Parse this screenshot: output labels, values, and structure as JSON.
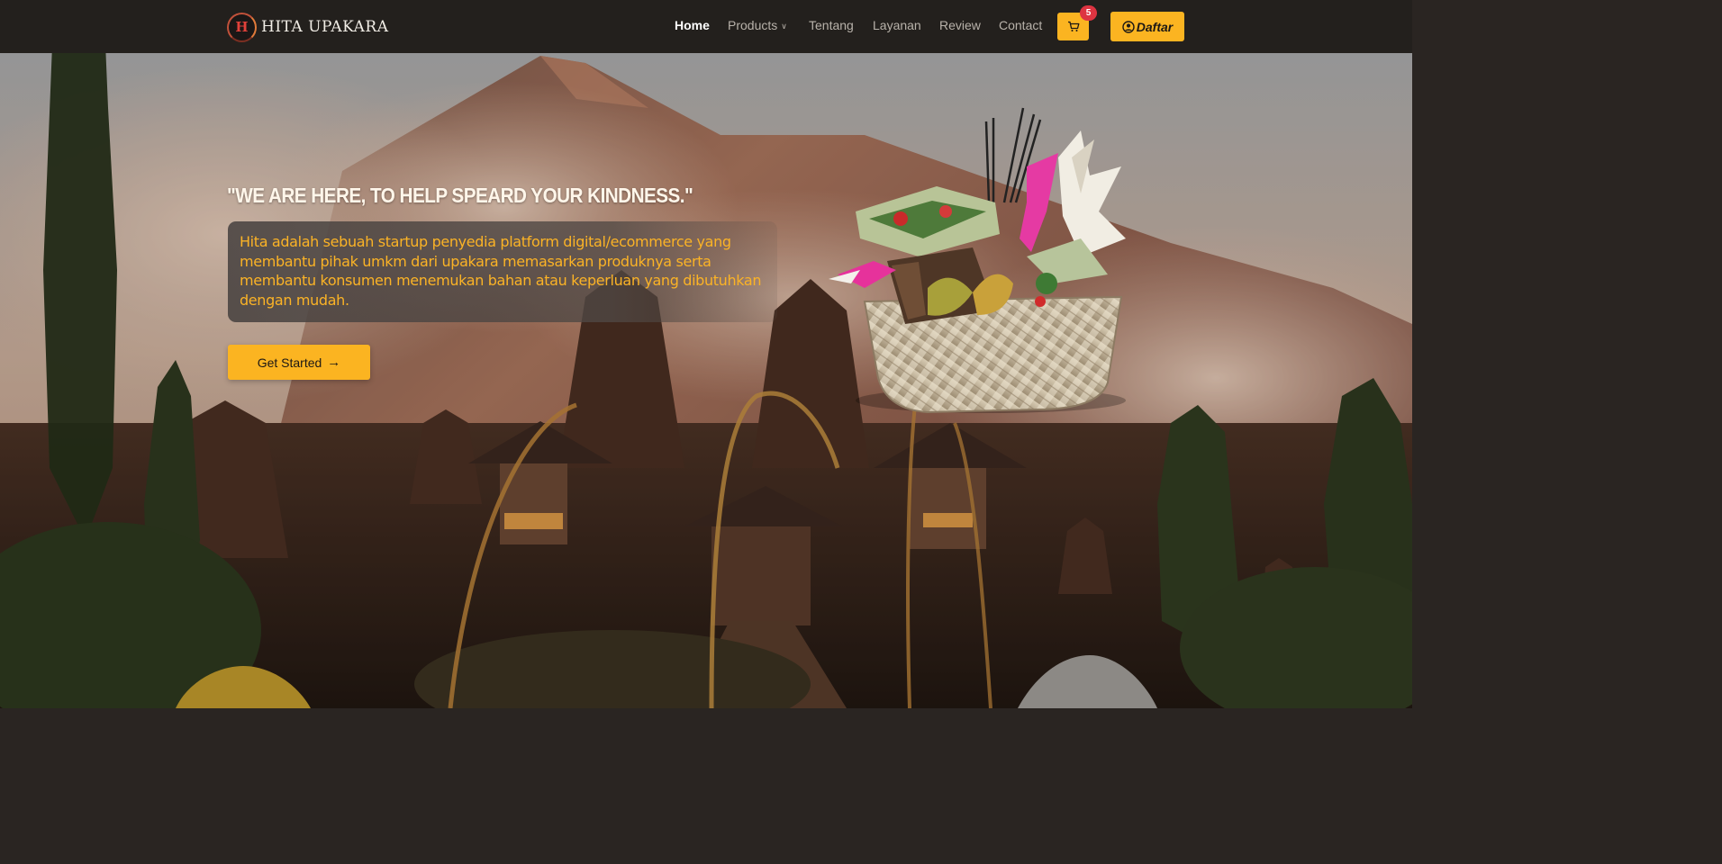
{
  "brand": {
    "logo_glyph": "H",
    "name": "HITA UPAKARA"
  },
  "nav": {
    "links": [
      {
        "label": "Home",
        "active": true
      },
      {
        "label": "Products",
        "dropdown": true
      },
      {
        "label": "Tentang"
      },
      {
        "label": "Layanan"
      },
      {
        "label": "Review"
      },
      {
        "label": "Contact"
      }
    ],
    "cart": {
      "icon": "cart-icon",
      "count": "5"
    },
    "register": {
      "icon": "user-circle-icon",
      "label": "Daftar"
    }
  },
  "hero": {
    "headline": "\"WE ARE HERE, TO HELP SPEARD YOUR KINDNESS.\"",
    "description": "Hita adalah sebuah startup penyedia platform digital/ecommerce yang membantu pihak umkm dari upakara memasarkan produknya serta membantu konsumen menemukan bahan atau keperluan yang dibutuhkan dengan mudah.",
    "cta_label": "Get Started",
    "cta_icon": "arrow-right-icon"
  },
  "colors": {
    "accent": "#fbb421",
    "navbar": "#23201d",
    "badge": "#dd3441",
    "description_text": "#fbb326"
  }
}
